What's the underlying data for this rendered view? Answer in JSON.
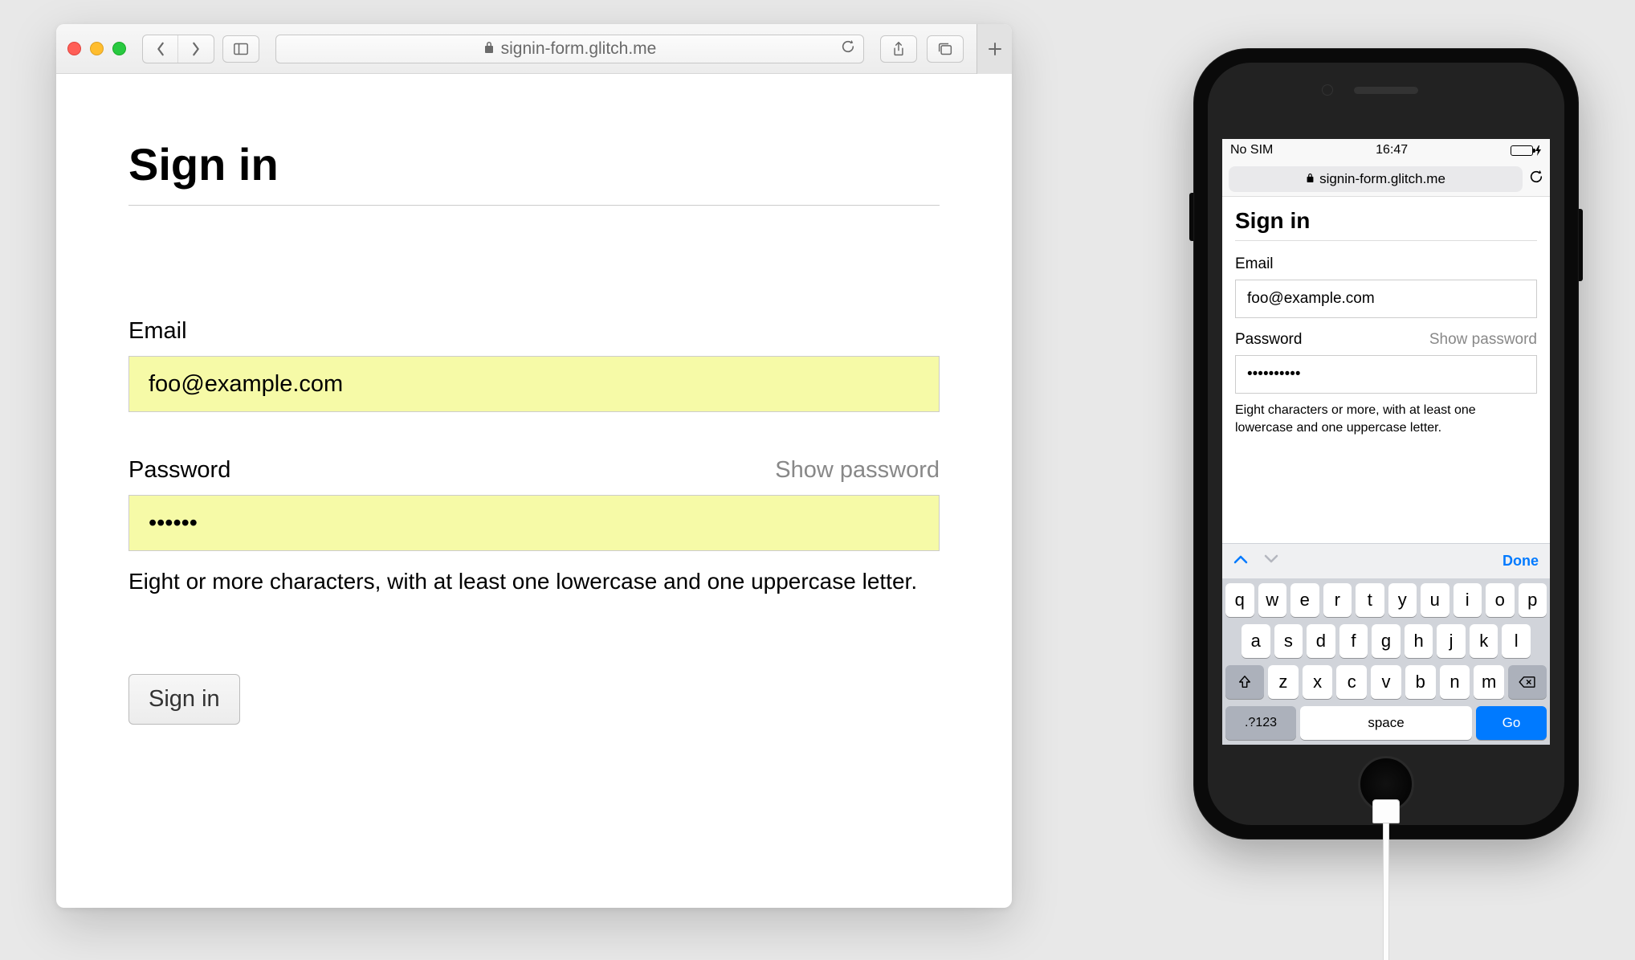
{
  "desktop": {
    "url": "signin-form.glitch.me",
    "page_title": "Sign in",
    "email": {
      "label": "Email",
      "value": "foo@example.com"
    },
    "password": {
      "label": "Password",
      "show_label": "Show password",
      "value": "••••••",
      "hint": "Eight or more characters, with at least one lowercase and one uppercase letter."
    },
    "submit_label": "Sign in"
  },
  "mobile": {
    "status": {
      "carrier": "No SIM",
      "time": "16:47"
    },
    "url": "signin-form.glitch.me",
    "page_title": "Sign in",
    "email": {
      "label": "Email",
      "value": "foo@example.com"
    },
    "password": {
      "label": "Password",
      "show_label": "Show password",
      "value": "••••••••••",
      "hint": "Eight characters or more, with at least one lowercase and one uppercase letter."
    },
    "keyboard": {
      "done_label": "Done",
      "row1": [
        "q",
        "w",
        "e",
        "r",
        "t",
        "y",
        "u",
        "i",
        "o",
        "p"
      ],
      "row2": [
        "a",
        "s",
        "d",
        "f",
        "g",
        "h",
        "j",
        "k",
        "l"
      ],
      "row3": [
        "z",
        "x",
        "c",
        "v",
        "b",
        "n",
        "m"
      ],
      "numkey_label": ".?123",
      "space_label": "space",
      "go_label": "Go"
    }
  }
}
